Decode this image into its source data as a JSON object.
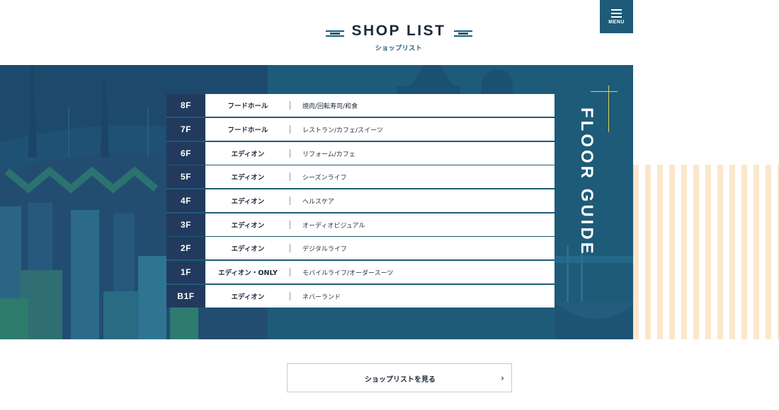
{
  "header": {
    "title": "SHOP LIST",
    "subtitle": "ショップリスト",
    "menu_label": "MENU"
  },
  "floor_guide": {
    "heading": "FLOOR GUIDE",
    "floors": [
      {
        "floor": "8F",
        "store": "フードホール",
        "category": "焼肉/回転寿司/和食"
      },
      {
        "floor": "7F",
        "store": "フードホール",
        "category": "レストラン/カフェ/スイーツ"
      },
      {
        "floor": "6F",
        "store": "エディオン",
        "category": "リフォーム/カフェ"
      },
      {
        "floor": "5F",
        "store": "エディオン",
        "category": "シーズンライフ"
      },
      {
        "floor": "4F",
        "store": "エディオン",
        "category": "ヘルスケア"
      },
      {
        "floor": "3F",
        "store": "エディオン",
        "category": "オーディオビジュアル"
      },
      {
        "floor": "2F",
        "store": "エディオン",
        "category": "デジタルライフ"
      },
      {
        "floor": "1F",
        "store": "エディオン・ONLY",
        "category": "モバイルライフ/オーダースーツ"
      },
      {
        "floor": "B1F",
        "store": "エディオン",
        "category": "ネバーランド"
      }
    ]
  },
  "cta": {
    "label": "ショップリストを見る",
    "arrow": "›"
  },
  "colors": {
    "panel": "#1e5b78",
    "floor_badge": "#223a5e",
    "accent_yellow": "#d8d45a",
    "stripe": "#fbe7cc"
  },
  "icons": {
    "menu": "hamburger-icon",
    "arrow": "chevron-right-icon"
  }
}
